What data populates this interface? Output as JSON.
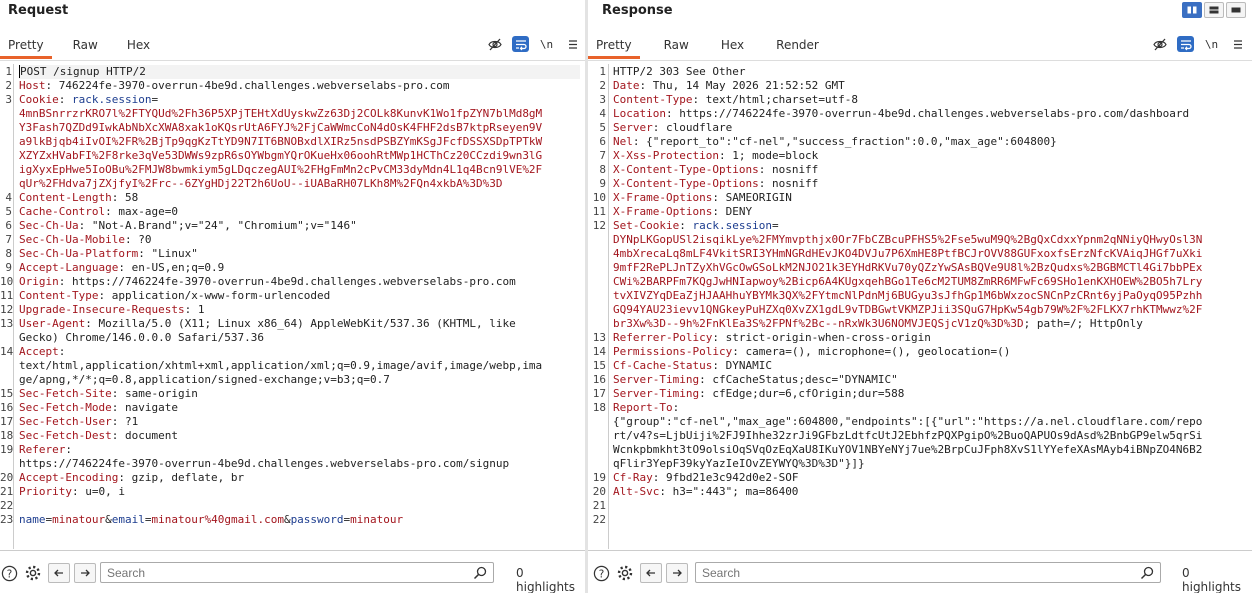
{
  "request": {
    "title": "Request",
    "tabs": [
      "Pretty",
      "Raw",
      "Hex"
    ],
    "active_tab": "Pretty",
    "lines": [
      {
        "n": "1",
        "segs": [
          [
            "t",
            "POST /signup HTTP/2"
          ]
        ],
        "hl": true
      },
      {
        "n": "2",
        "segs": [
          [
            "k",
            "Host"
          ],
          [
            "t",
            ": 746224fe-3970-overrun-4be9d.challenges.webverselabs-pro.com"
          ]
        ]
      },
      {
        "n": "3",
        "segs": [
          [
            "k",
            "Cookie"
          ],
          [
            "t",
            ": "
          ],
          [
            "n",
            "rack.session"
          ],
          [
            "t",
            "="
          ]
        ]
      },
      {
        "n": "",
        "segs": [
          [
            "sv",
            "4mnBSnrrzrKRO7l%2FTYQUd%2Fh36P5XPjTEHtXdUyskwZz63Dj2COLk8KunvK1Wo1fpZYN7blMd8gM"
          ]
        ]
      },
      {
        "n": "",
        "segs": [
          [
            "sv",
            "Y3Fash7QZDd9IwkAbNbXcXWA8xak1oKQsrUtA6FYJ%2FjCaWWmcCoN4dOsK4FHF2dsB7ktpRseyen9V"
          ]
        ]
      },
      {
        "n": "",
        "segs": [
          [
            "sv",
            "a9lkBjqb4iIvOI%2FR%2BjTp9qgKzTtYD9N7IT6BNOBxdlXIRz5nsdPSBZYmKSgJFcfDSSXSDpTPTkW"
          ]
        ]
      },
      {
        "n": "",
        "segs": [
          [
            "sv",
            "XZYZxHVabFI%2F8rke3qVe53DWWs9zpR6sOYWbgmYQrOKueHx06oohRtMWp1HCThCz20CCzdi9wn3lG"
          ]
        ]
      },
      {
        "n": "",
        "segs": [
          [
            "sv",
            "igXyxEpHwe5IoOBu%2FMJW8bwmkiym5gLDqczegAUI%2FHgFmMn2cPvCM33dyMdn4L1q4Bcn9lVE%2F"
          ]
        ]
      },
      {
        "n": "",
        "segs": [
          [
            "sv",
            "qUr%2FHdva7jZXjfyI%2Frc--6ZYgHDj22T2h6UoU--iUABaRH07LKh8M%2FQn4xkbA%3D%3D"
          ]
        ]
      },
      {
        "n": "4",
        "segs": [
          [
            "k",
            "Content-Length"
          ],
          [
            "t",
            ": 58"
          ]
        ]
      },
      {
        "n": "5",
        "segs": [
          [
            "k",
            "Cache-Control"
          ],
          [
            "t",
            ": max-age=0"
          ]
        ]
      },
      {
        "n": "6",
        "segs": [
          [
            "k",
            "Sec-Ch-Ua"
          ],
          [
            "t",
            ": \"Not-A.Brand\";v=\"24\", \"Chromium\";v=\"146\""
          ]
        ]
      },
      {
        "n": "7",
        "segs": [
          [
            "k",
            "Sec-Ch-Ua-Mobile"
          ],
          [
            "t",
            ": ?0"
          ]
        ]
      },
      {
        "n": "8",
        "segs": [
          [
            "k",
            "Sec-Ch-Ua-Platform"
          ],
          [
            "t",
            ": \"Linux\""
          ]
        ]
      },
      {
        "n": "9",
        "segs": [
          [
            "k",
            "Accept-Language"
          ],
          [
            "t",
            ": en-US,en;q=0.9"
          ]
        ]
      },
      {
        "n": "10",
        "segs": [
          [
            "k",
            "Origin"
          ],
          [
            "t",
            ": https://746224fe-3970-overrun-4be9d.challenges.webverselabs-pro.com"
          ]
        ]
      },
      {
        "n": "11",
        "segs": [
          [
            "k",
            "Content-Type"
          ],
          [
            "t",
            ": application/x-www-form-urlencoded"
          ]
        ]
      },
      {
        "n": "12",
        "segs": [
          [
            "k",
            "Upgrade-Insecure-Requests"
          ],
          [
            "t",
            ": 1"
          ]
        ]
      },
      {
        "n": "13",
        "segs": [
          [
            "k",
            "User-Agent"
          ],
          [
            "t",
            ": Mozilla/5.0 (X11; Linux x86_64) AppleWebKit/537.36 (KHTML, like"
          ]
        ]
      },
      {
        "n": "",
        "segs": [
          [
            "t",
            "Gecko) Chrome/146.0.0.0 Safari/537.36"
          ]
        ]
      },
      {
        "n": "14",
        "segs": [
          [
            "k",
            "Accept"
          ],
          [
            "t",
            ":"
          ]
        ]
      },
      {
        "n": "",
        "segs": [
          [
            "t",
            "text/html,application/xhtml+xml,application/xml;q=0.9,image/avif,image/webp,ima"
          ]
        ]
      },
      {
        "n": "",
        "segs": [
          [
            "t",
            "ge/apng,*/*;q=0.8,application/signed-exchange;v=b3;q=0.7"
          ]
        ]
      },
      {
        "n": "15",
        "segs": [
          [
            "k",
            "Sec-Fetch-Site"
          ],
          [
            "t",
            ": same-origin"
          ]
        ]
      },
      {
        "n": "16",
        "segs": [
          [
            "k",
            "Sec-Fetch-Mode"
          ],
          [
            "t",
            ": navigate"
          ]
        ]
      },
      {
        "n": "17",
        "segs": [
          [
            "k",
            "Sec-Fetch-User"
          ],
          [
            "t",
            ": ?1"
          ]
        ]
      },
      {
        "n": "18",
        "segs": [
          [
            "k",
            "Sec-Fetch-Dest"
          ],
          [
            "t",
            ": document"
          ]
        ]
      },
      {
        "n": "19",
        "segs": [
          [
            "k",
            "Referer"
          ],
          [
            "t",
            ":"
          ]
        ]
      },
      {
        "n": "",
        "segs": [
          [
            "t",
            "https://746224fe-3970-overrun-4be9d.challenges.webverselabs-pro.com/signup"
          ]
        ]
      },
      {
        "n": "20",
        "segs": [
          [
            "k",
            "Accept-Encoding"
          ],
          [
            "t",
            ": gzip, deflate, br"
          ]
        ]
      },
      {
        "n": "21",
        "segs": [
          [
            "k",
            "Priority"
          ],
          [
            "t",
            ": u=0, i"
          ]
        ]
      },
      {
        "n": "22",
        "segs": []
      },
      {
        "n": "23",
        "segs": [
          [
            "n",
            "name"
          ],
          [
            "t",
            "="
          ],
          [
            "sv",
            "minatour"
          ],
          [
            "t",
            "&"
          ],
          [
            "n",
            "email"
          ],
          [
            "t",
            "="
          ],
          [
            "sv",
            "minatour%40gmail.com"
          ],
          [
            "t",
            "&"
          ],
          [
            "n",
            "password"
          ],
          [
            "t",
            "="
          ],
          [
            "sv",
            "minatour"
          ]
        ]
      }
    ],
    "search_placeholder": "Search",
    "highlights": "0 highlights"
  },
  "response": {
    "title": "Response",
    "tabs": [
      "Pretty",
      "Raw",
      "Hex",
      "Render"
    ],
    "active_tab": "Pretty",
    "lines": [
      {
        "n": "1",
        "segs": [
          [
            "t",
            "HTTP/2 303 See Other"
          ]
        ]
      },
      {
        "n": "2",
        "segs": [
          [
            "k",
            "Date"
          ],
          [
            "t",
            ": Thu, 14 May 2026 21:52:52 GMT"
          ]
        ]
      },
      {
        "n": "3",
        "segs": [
          [
            "k",
            "Content-Type"
          ],
          [
            "t",
            ": text/html;charset=utf-8"
          ]
        ]
      },
      {
        "n": "4",
        "segs": [
          [
            "k",
            "Location"
          ],
          [
            "t",
            ": https://746224fe-3970-overrun-4be9d.challenges.webverselabs-pro.com/dashboard"
          ]
        ]
      },
      {
        "n": "5",
        "segs": [
          [
            "k",
            "Server"
          ],
          [
            "t",
            ": cloudflare"
          ]
        ]
      },
      {
        "n": "6",
        "segs": [
          [
            "k",
            "Nel"
          ],
          [
            "t",
            ": {\"report_to\":\"cf-nel\",\"success_fraction\":0.0,\"max_age\":604800}"
          ]
        ]
      },
      {
        "n": "7",
        "segs": [
          [
            "k",
            "X-Xss-Protection"
          ],
          [
            "t",
            ": 1; mode=block"
          ]
        ]
      },
      {
        "n": "8",
        "segs": [
          [
            "k",
            "X-Content-Type-Options"
          ],
          [
            "t",
            ": nosniff"
          ]
        ]
      },
      {
        "n": "9",
        "segs": [
          [
            "k",
            "X-Content-Type-Options"
          ],
          [
            "t",
            ": nosniff"
          ]
        ]
      },
      {
        "n": "10",
        "segs": [
          [
            "k",
            "X-Frame-Options"
          ],
          [
            "t",
            ": SAMEORIGIN"
          ]
        ]
      },
      {
        "n": "11",
        "segs": [
          [
            "k",
            "X-Frame-Options"
          ],
          [
            "t",
            ": DENY"
          ]
        ]
      },
      {
        "n": "12",
        "segs": [
          [
            "k",
            "Set-Cookie"
          ],
          [
            "t",
            ": "
          ],
          [
            "n",
            "rack.session"
          ],
          [
            "t",
            "="
          ]
        ]
      },
      {
        "n": "",
        "segs": [
          [
            "sv",
            "DYNpLKGopUSl2isqikLye%2FMYmvpthjx0Or7FbCZBcuPFHS5%2Fse5wuM9Q%2BgQxCdxxYpnm2qNNiyQHwyOsl3N"
          ]
        ]
      },
      {
        "n": "",
        "segs": [
          [
            "sv",
            "4mbXrecaLq8mLF4VkitSRI3YHmNGRdHEvJKO4DVJu7P6XmHE8PtfBCJrOVV88GUFxoxfsErzNfcKVAiqJHGf7uXki"
          ]
        ]
      },
      {
        "n": "",
        "segs": [
          [
            "sv",
            "9mfF2RePLJnTZyXhVGcOwGSoLkM2NJO21k3EYHdRKVu70yQZzYwSAsBQVe9U8l%2BzQudxs%2BGBMCTl4Gi7bbPEx"
          ]
        ]
      },
      {
        "n": "",
        "segs": [
          [
            "sv",
            "CWi%2BARPFm7KQgJwHNIapwoy%2Bicp6A4KUgxqehBGo1Te6cM2TUM8ZmRR6MFwFc69SHo1enKXHOEW%2BO5h7Lry"
          ]
        ]
      },
      {
        "n": "",
        "segs": [
          [
            "sv",
            "tvXIVZYqDEaZjHJAAHhuYBYMk3QX%2FYtmcNlPdnMj6BUGyu3sJfhGp1M6bWxzocSNCnPzCRnt6yjPaOyqO95Pzhh"
          ]
        ]
      },
      {
        "n": "",
        "segs": [
          [
            "sv",
            "GQ94YAU23ievv1QNGkeyPuHZXq0XvZX1gdL9vTDBGwtVKMZPJii3SQuG7HpKw54gb79W%2F%2FLKX7rhKTMwwz%2F"
          ]
        ]
      },
      {
        "n": "",
        "segs": [
          [
            "sv",
            "br3Xw%3D--9h%2FnKlEa3S%2FPNf%2Bc--nRxWk3U6NOMVJEQSjcV1zQ%3D%3D"
          ],
          [
            "t",
            "; path=/; HttpOnly"
          ]
        ]
      },
      {
        "n": "13",
        "segs": [
          [
            "k",
            "Referrer-Policy"
          ],
          [
            "t",
            ": strict-origin-when-cross-origin"
          ]
        ]
      },
      {
        "n": "14",
        "segs": [
          [
            "k",
            "Permissions-Policy"
          ],
          [
            "t",
            ": camera=(), microphone=(), geolocation=()"
          ]
        ]
      },
      {
        "n": "15",
        "segs": [
          [
            "k",
            "Cf-Cache-Status"
          ],
          [
            "t",
            ": DYNAMIC"
          ]
        ]
      },
      {
        "n": "16",
        "segs": [
          [
            "k",
            "Server-Timing"
          ],
          [
            "t",
            ": cfCacheStatus;desc=\"DYNAMIC\""
          ]
        ]
      },
      {
        "n": "17",
        "segs": [
          [
            "k",
            "Server-Timing"
          ],
          [
            "t",
            ": cfEdge;dur=6,cfOrigin;dur=588"
          ]
        ]
      },
      {
        "n": "18",
        "segs": [
          [
            "k",
            "Report-To"
          ],
          [
            "t",
            ":"
          ]
        ]
      },
      {
        "n": "",
        "segs": [
          [
            "t",
            "{\"group\":\"cf-nel\",\"max_age\":604800,\"endpoints\":[{\"url\":\"https://a.nel.cloudflare.com/repo"
          ]
        ]
      },
      {
        "n": "",
        "segs": [
          [
            "t",
            "rt/v4?s=LjbUiji%2FJ9Ihhe32zrJi9GFbzLdtfcUtJ2EbhfzPQXPgipO%2BuoQAPUOs9dAsd%2BnbGP9elw5qrSi"
          ]
        ]
      },
      {
        "n": "",
        "segs": [
          [
            "t",
            "Wcnkpbmkht3tO9olsiOqSVqOzEqXaU8IKuYOV1NBYeNYj7ue%2BrpCuJFph8XvS1lYYefeXAsMAyb4iBNpZO4N6B2"
          ]
        ]
      },
      {
        "n": "",
        "segs": [
          [
            "t",
            "qFlir3YepF39kyYazIeIOvZEYWYQ%3D%3D\"}]}"
          ]
        ]
      },
      {
        "n": "19",
        "segs": [
          [
            "k",
            "Cf-Ray"
          ],
          [
            "t",
            ": 9fbd21e3c942d0e2-SOF"
          ]
        ]
      },
      {
        "n": "20",
        "segs": [
          [
            "k",
            "Alt-Svc"
          ],
          [
            "t",
            ": h3=\":443\"; ma=86400"
          ]
        ]
      },
      {
        "n": "21",
        "segs": []
      },
      {
        "n": "22",
        "segs": []
      }
    ],
    "search_placeholder": "Search",
    "highlights": "0 highlights"
  },
  "icons": {
    "hide": "eye-slash-icon",
    "wrap": "wrap-lines-icon",
    "newline": "\\n",
    "menu": "hamburger-menu-icon",
    "help": "?",
    "settings": "gear-icon",
    "back": "arrow-left-icon",
    "forward": "arrow-right-icon",
    "search": "magnifier-icon"
  },
  "colors": {
    "accent": "#e8622a",
    "header_key": "#a3161e",
    "param_name": "#1d3d8f",
    "selected_icon": "#2f6cc4"
  }
}
